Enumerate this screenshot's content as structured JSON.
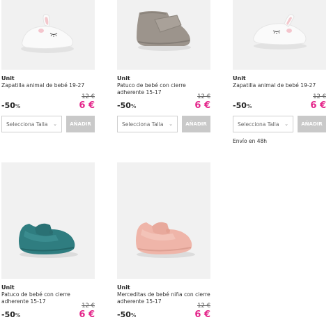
{
  "products": [
    {
      "brand": "Unit",
      "name": "Zapatilla animal de bebé 19-27",
      "old_price": "12 €",
      "discount": "-50",
      "discount_unit": "%",
      "new_price": "6 €",
      "size_placeholder": "Selecciona Talla",
      "add_label": "AÑADIR",
      "image": "white-bunny-slipper",
      "shipping": ""
    },
    {
      "brand": "Unit",
      "name": "Patuco de bebé con cierre adherente 15-17",
      "old_price": "12 €",
      "discount": "-50",
      "discount_unit": "%",
      "new_price": "6 €",
      "size_placeholder": "Selecciona Talla",
      "add_label": "AÑADIR",
      "image": "grey-bootie",
      "shipping": ""
    },
    {
      "brand": "Unit",
      "name": "Zapatilla animal de bebé 19-27",
      "old_price": "12 €",
      "discount": "-50",
      "discount_unit": "%",
      "new_price": "6 €",
      "size_placeholder": "Selecciona Talla",
      "add_label": "AÑADIR",
      "image": "white-bunny-slipper",
      "shipping": "Envío en 48h"
    },
    {
      "brand": "Unit",
      "name": "Patuco de bebé con cierre adherente 15-17",
      "old_price": "12 €",
      "discount": "-50",
      "discount_unit": "%",
      "new_price": "6 €",
      "image": "teal-mary-jane"
    },
    {
      "brand": "Unit",
      "name": "Merceditas de bebé niña con cierre adherente 15-17",
      "old_price": "12 €",
      "discount": "-50",
      "discount_unit": "%",
      "new_price": "6 €",
      "image": "pink-mary-jane"
    }
  ],
  "colors": {
    "price_accent": "#e4258a",
    "image_bg": "#f1f1f1",
    "button_disabled": "#c9c9c9",
    "teal_shoe": "#2f7d80",
    "pink_shoe": "#efb5a9",
    "grey_shoe": "#9c948c"
  }
}
